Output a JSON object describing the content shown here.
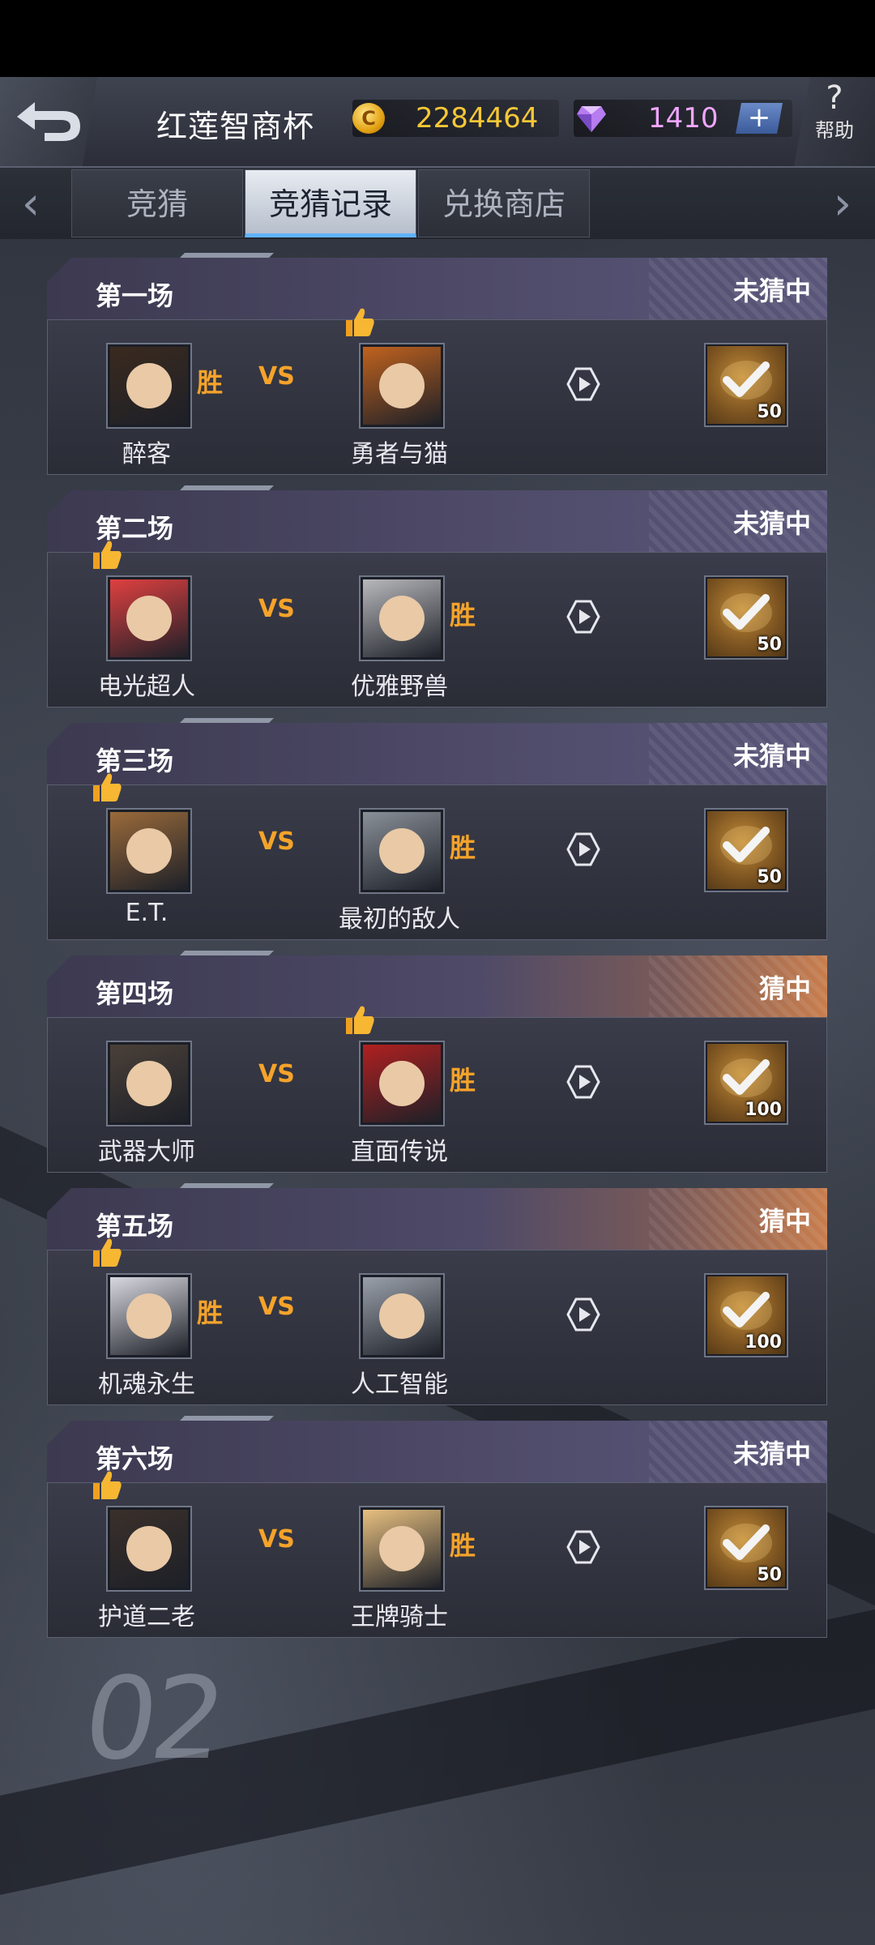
{
  "header": {
    "title": "红莲智商杯",
    "coins": "2284464",
    "gems": "1410",
    "plus_label": "+",
    "help_label": "帮助",
    "help_symbol": "?"
  },
  "tabs": [
    {
      "label": "竞猜",
      "active": false
    },
    {
      "label": "竞猜记录",
      "active": true
    },
    {
      "label": "兑换商店",
      "active": false
    }
  ],
  "nav": {
    "left_arrow": "‹",
    "right_arrow": "›"
  },
  "background_text": "02",
  "vs_label": "VS",
  "win_label": "胜",
  "matches": [
    {
      "label": "第一场",
      "result": "未猜中",
      "left": "醉客",
      "right": "勇者与猫",
      "winner": "left",
      "thumb": "right",
      "reward": "50",
      "left_color": "#3a2a1e",
      "right_color": "#c0621e"
    },
    {
      "label": "第二场",
      "result": "未猜中",
      "left": "电光超人",
      "right": "优雅野兽",
      "winner": "right",
      "thumb": "left",
      "reward": "50",
      "left_color": "#e04040",
      "right_color": "#b8b8bc"
    },
    {
      "label": "第三场",
      "result": "未猜中",
      "left": "E.T.",
      "right": "最初的敌人",
      "winner": "right",
      "thumb": "left",
      "reward": "50",
      "left_color": "#9a6a3a",
      "right_color": "#8a9098"
    },
    {
      "label": "第四场",
      "result": "猜中",
      "left": "武器大师",
      "right": "直面传说",
      "winner": "right",
      "thumb": "right",
      "reward": "100",
      "left_color": "#4a4038",
      "right_color": "#b02020"
    },
    {
      "label": "第五场",
      "result": "猜中",
      "left": "机魂永生",
      "right": "人工智能",
      "winner": "left",
      "thumb": "left",
      "reward": "100",
      "left_color": "#d8d8e0",
      "right_color": "#9aa0aa"
    },
    {
      "label": "第六场",
      "result": "未猜中",
      "left": "护道二老",
      "right": "王牌骑士",
      "winner": "right",
      "thumb": "left",
      "reward": "50",
      "left_color": "#3a302a",
      "right_color": "#e8c080"
    }
  ],
  "colors": {
    "accent_win": "#f5a32a",
    "coin": "#f7c736",
    "gem": "#f0a6ff",
    "tab_active_bar": "#5fb3ff"
  }
}
